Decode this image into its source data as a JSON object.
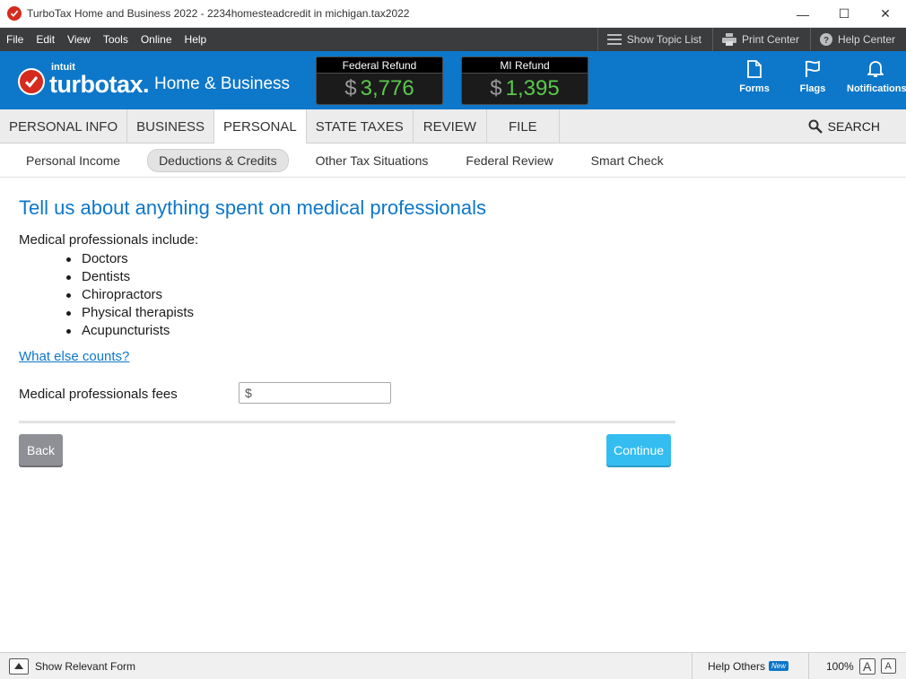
{
  "window": {
    "title": "TurboTax Home and Business 2022 - 2234homesteadcredit in michigan.tax2022",
    "minimize": "—",
    "maximize": "☐",
    "close": "✕"
  },
  "menu": {
    "items": [
      "File",
      "Edit",
      "View",
      "Tools",
      "Online",
      "Help"
    ],
    "show_topic_list": "Show Topic List",
    "print_center": "Print Center",
    "help_center": "Help Center"
  },
  "header": {
    "logo_intuit": "intuit",
    "logo_turbotax": "turbotax.",
    "edition": "Home & Business",
    "federal_refund": {
      "label": "Federal Refund",
      "currency": "$",
      "amount": "3,776"
    },
    "state_refund": {
      "label": "MI Refund",
      "currency": "$",
      "amount": "1,395"
    },
    "forms_label": "Forms",
    "flags_label": "Flags",
    "notifications_label": "Notifications"
  },
  "tabs": {
    "items": [
      "PERSONAL INFO",
      "BUSINESS",
      "PERSONAL",
      "STATE TAXES",
      "REVIEW",
      "FILE"
    ],
    "active": "PERSONAL",
    "search": "SEARCH"
  },
  "subtabs": {
    "items": [
      "Personal Income",
      "Deductions & Credits",
      "Other Tax Situations",
      "Federal Review",
      "Smart Check"
    ],
    "active": "Deductions & Credits"
  },
  "main": {
    "title": "Tell us about anything spent on medical professionals",
    "intro": "Medical professionals include:",
    "bullets": [
      "Doctors",
      "Dentists",
      "Chiropractors",
      "Physical therapists",
      "Acupuncturists"
    ],
    "link": "What else counts?",
    "field_label": "Medical professionals fees",
    "field_prefix": "$",
    "field_value": "",
    "back": "Back",
    "continue": "Continue"
  },
  "statusbar": {
    "show_relevant_form": "Show Relevant Form",
    "help_others": "Help Others",
    "new_badge": "New",
    "zoom": "100%",
    "zoom_in": "A",
    "zoom_out": "A"
  },
  "colors": {
    "brand_blue": "#0d77c9",
    "menu_dark": "#3b3c3d",
    "refund_green": "#5ac94b",
    "continue_blue": "#34bdf1",
    "back_gray": "#8e9096",
    "logo_red": "#d52b1e"
  },
  "icons": {
    "app": "turbotax-check-icon",
    "topic_list": "list-icon",
    "print": "printer-icon",
    "help": "question-circle-icon",
    "forms": "document-icon",
    "flags": "flag-icon",
    "notifications": "bell-icon",
    "search": "magnifier-icon",
    "show_form": "triangle-up-icon"
  }
}
